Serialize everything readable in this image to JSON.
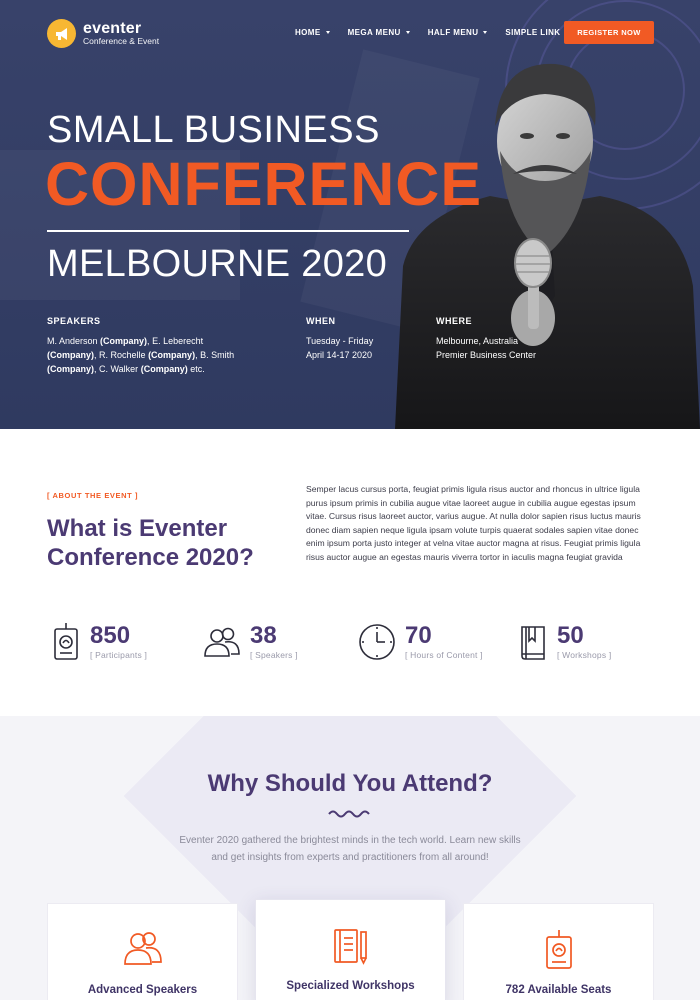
{
  "colors": {
    "accent": "#f15a24",
    "brand_purple": "#4b3a73",
    "hero_bg": "#353f66",
    "logo_yellow": "#f7b733"
  },
  "nav": {
    "logo_name": "eventer",
    "logo_tagline": "Conference & Event",
    "items": [
      {
        "label": "HOME",
        "has_dropdown": true
      },
      {
        "label": "MEGA MENU",
        "has_dropdown": true
      },
      {
        "label": "HALF MENU",
        "has_dropdown": true
      },
      {
        "label": "SIMPLE LINK",
        "has_dropdown": false
      }
    ],
    "cta": "REGISTER NOW"
  },
  "hero": {
    "line1": "SMALL BUSINESS",
    "line2": "CONFERENCE",
    "line3": "MELBOURNE 2020",
    "speakers_heading": "SPEAKERS",
    "speakers_text": [
      {
        "name": "M. Anderson",
        "company": "(Company)"
      },
      {
        "name": "E. Leberecht",
        "company": "(Company)"
      },
      {
        "name": "R. Rochelle",
        "company": "(Company)"
      },
      {
        "name": "B. Smith",
        "company": "(Company)"
      },
      {
        "name": "C. Walker",
        "company": "(Company)"
      }
    ],
    "speakers_suffix": "etc.",
    "when_heading": "WHEN",
    "when_line1": "Tuesday - Friday",
    "when_line2": "April 14-17 2020",
    "where_heading": "WHERE",
    "where_line1": "Melbourne, Australia",
    "where_line2": "Premier Business Center"
  },
  "about": {
    "eyebrow": "[ ABOUT THE EVENT ]",
    "title": "What is Eventer Conference 2020?",
    "body": "Semper lacus cursus porta, feugiat primis ligula risus auctor and rhoncus in ultrice ligula purus ipsum primis in cubilia augue vitae laoreet augue in cubilia augue egestas ipsum vitae. Cursus risus laoreet auctor, varius augue. At nulla dolor sapien risus luctus mauris donec diam sapien neque ligula ipsam volute turpis quaerat sodales sapien vitae donec enim ipsum porta justo integer at velna vitae auctor magna at risus. Feugiat primis ligula risus auctor augue an egestas mauris viverra tortor in iaculis magna feugiat gravida"
  },
  "stats": [
    {
      "icon": "badge-icon",
      "value": "850",
      "label": "[ Participants ]"
    },
    {
      "icon": "people-icon",
      "value": "38",
      "label": "[ Speakers ]"
    },
    {
      "icon": "clock-icon",
      "value": "70",
      "label": "[ Hours of Content ]"
    },
    {
      "icon": "book-icon",
      "value": "50",
      "label": "[ Workshops ]"
    }
  ],
  "why": {
    "title": "Why Should You Attend?",
    "subtitle_line1": "Eventer 2020 gathered the brightest minds in the tech world. Learn new skills",
    "subtitle_line2": "and get insights from experts and practitioners from all around!",
    "cards": [
      {
        "icon": "people-icon",
        "title": "Advanced Speakers"
      },
      {
        "icon": "notebook-pencil-icon",
        "title": "Specialized Workshops"
      },
      {
        "icon": "badge-icon",
        "title": "782 Available Seats"
      }
    ]
  }
}
